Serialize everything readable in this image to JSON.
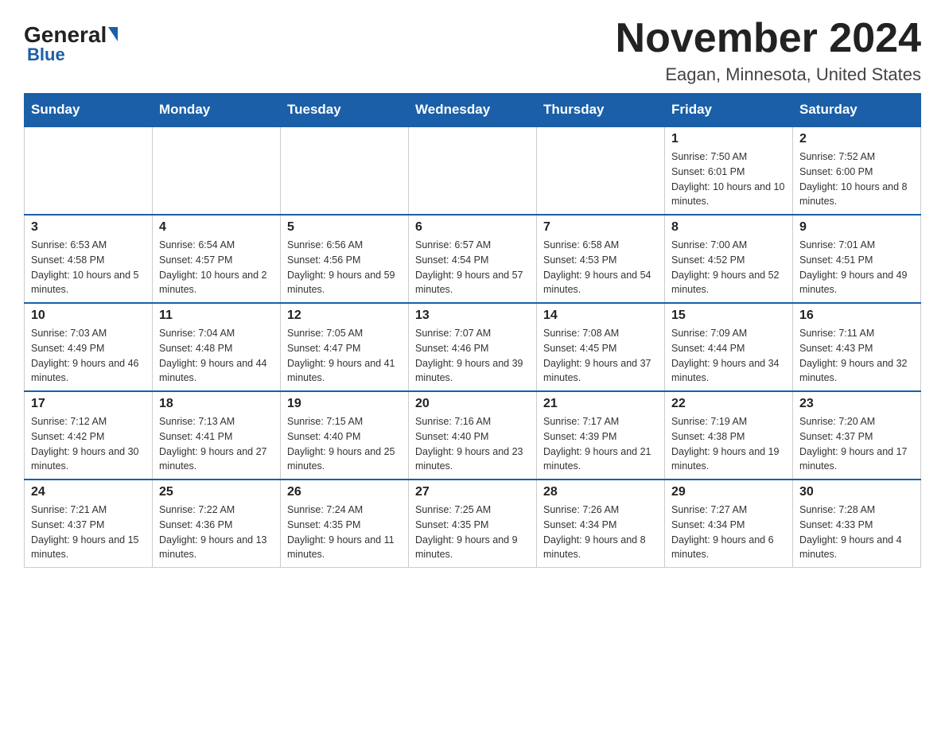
{
  "header": {
    "logo_general": "General",
    "logo_blue": "Blue",
    "main_title": "November 2024",
    "subtitle": "Eagan, Minnesota, United States"
  },
  "days_of_week": [
    "Sunday",
    "Monday",
    "Tuesday",
    "Wednesday",
    "Thursday",
    "Friday",
    "Saturday"
  ],
  "weeks": [
    [
      {
        "day": "",
        "sunrise": "",
        "sunset": "",
        "daylight": ""
      },
      {
        "day": "",
        "sunrise": "",
        "sunset": "",
        "daylight": ""
      },
      {
        "day": "",
        "sunrise": "",
        "sunset": "",
        "daylight": ""
      },
      {
        "day": "",
        "sunrise": "",
        "sunset": "",
        "daylight": ""
      },
      {
        "day": "",
        "sunrise": "",
        "sunset": "",
        "daylight": ""
      },
      {
        "day": "1",
        "sunrise": "Sunrise: 7:50 AM",
        "sunset": "Sunset: 6:01 PM",
        "daylight": "Daylight: 10 hours and 10 minutes."
      },
      {
        "day": "2",
        "sunrise": "Sunrise: 7:52 AM",
        "sunset": "Sunset: 6:00 PM",
        "daylight": "Daylight: 10 hours and 8 minutes."
      }
    ],
    [
      {
        "day": "3",
        "sunrise": "Sunrise: 6:53 AM",
        "sunset": "Sunset: 4:58 PM",
        "daylight": "Daylight: 10 hours and 5 minutes."
      },
      {
        "day": "4",
        "sunrise": "Sunrise: 6:54 AM",
        "sunset": "Sunset: 4:57 PM",
        "daylight": "Daylight: 10 hours and 2 minutes."
      },
      {
        "day": "5",
        "sunrise": "Sunrise: 6:56 AM",
        "sunset": "Sunset: 4:56 PM",
        "daylight": "Daylight: 9 hours and 59 minutes."
      },
      {
        "day": "6",
        "sunrise": "Sunrise: 6:57 AM",
        "sunset": "Sunset: 4:54 PM",
        "daylight": "Daylight: 9 hours and 57 minutes."
      },
      {
        "day": "7",
        "sunrise": "Sunrise: 6:58 AM",
        "sunset": "Sunset: 4:53 PM",
        "daylight": "Daylight: 9 hours and 54 minutes."
      },
      {
        "day": "8",
        "sunrise": "Sunrise: 7:00 AM",
        "sunset": "Sunset: 4:52 PM",
        "daylight": "Daylight: 9 hours and 52 minutes."
      },
      {
        "day": "9",
        "sunrise": "Sunrise: 7:01 AM",
        "sunset": "Sunset: 4:51 PM",
        "daylight": "Daylight: 9 hours and 49 minutes."
      }
    ],
    [
      {
        "day": "10",
        "sunrise": "Sunrise: 7:03 AM",
        "sunset": "Sunset: 4:49 PM",
        "daylight": "Daylight: 9 hours and 46 minutes."
      },
      {
        "day": "11",
        "sunrise": "Sunrise: 7:04 AM",
        "sunset": "Sunset: 4:48 PM",
        "daylight": "Daylight: 9 hours and 44 minutes."
      },
      {
        "day": "12",
        "sunrise": "Sunrise: 7:05 AM",
        "sunset": "Sunset: 4:47 PM",
        "daylight": "Daylight: 9 hours and 41 minutes."
      },
      {
        "day": "13",
        "sunrise": "Sunrise: 7:07 AM",
        "sunset": "Sunset: 4:46 PM",
        "daylight": "Daylight: 9 hours and 39 minutes."
      },
      {
        "day": "14",
        "sunrise": "Sunrise: 7:08 AM",
        "sunset": "Sunset: 4:45 PM",
        "daylight": "Daylight: 9 hours and 37 minutes."
      },
      {
        "day": "15",
        "sunrise": "Sunrise: 7:09 AM",
        "sunset": "Sunset: 4:44 PM",
        "daylight": "Daylight: 9 hours and 34 minutes."
      },
      {
        "day": "16",
        "sunrise": "Sunrise: 7:11 AM",
        "sunset": "Sunset: 4:43 PM",
        "daylight": "Daylight: 9 hours and 32 minutes."
      }
    ],
    [
      {
        "day": "17",
        "sunrise": "Sunrise: 7:12 AM",
        "sunset": "Sunset: 4:42 PM",
        "daylight": "Daylight: 9 hours and 30 minutes."
      },
      {
        "day": "18",
        "sunrise": "Sunrise: 7:13 AM",
        "sunset": "Sunset: 4:41 PM",
        "daylight": "Daylight: 9 hours and 27 minutes."
      },
      {
        "day": "19",
        "sunrise": "Sunrise: 7:15 AM",
        "sunset": "Sunset: 4:40 PM",
        "daylight": "Daylight: 9 hours and 25 minutes."
      },
      {
        "day": "20",
        "sunrise": "Sunrise: 7:16 AM",
        "sunset": "Sunset: 4:40 PM",
        "daylight": "Daylight: 9 hours and 23 minutes."
      },
      {
        "day": "21",
        "sunrise": "Sunrise: 7:17 AM",
        "sunset": "Sunset: 4:39 PM",
        "daylight": "Daylight: 9 hours and 21 minutes."
      },
      {
        "day": "22",
        "sunrise": "Sunrise: 7:19 AM",
        "sunset": "Sunset: 4:38 PM",
        "daylight": "Daylight: 9 hours and 19 minutes."
      },
      {
        "day": "23",
        "sunrise": "Sunrise: 7:20 AM",
        "sunset": "Sunset: 4:37 PM",
        "daylight": "Daylight: 9 hours and 17 minutes."
      }
    ],
    [
      {
        "day": "24",
        "sunrise": "Sunrise: 7:21 AM",
        "sunset": "Sunset: 4:37 PM",
        "daylight": "Daylight: 9 hours and 15 minutes."
      },
      {
        "day": "25",
        "sunrise": "Sunrise: 7:22 AM",
        "sunset": "Sunset: 4:36 PM",
        "daylight": "Daylight: 9 hours and 13 minutes."
      },
      {
        "day": "26",
        "sunrise": "Sunrise: 7:24 AM",
        "sunset": "Sunset: 4:35 PM",
        "daylight": "Daylight: 9 hours and 11 minutes."
      },
      {
        "day": "27",
        "sunrise": "Sunrise: 7:25 AM",
        "sunset": "Sunset: 4:35 PM",
        "daylight": "Daylight: 9 hours and 9 minutes."
      },
      {
        "day": "28",
        "sunrise": "Sunrise: 7:26 AM",
        "sunset": "Sunset: 4:34 PM",
        "daylight": "Daylight: 9 hours and 8 minutes."
      },
      {
        "day": "29",
        "sunrise": "Sunrise: 7:27 AM",
        "sunset": "Sunset: 4:34 PM",
        "daylight": "Daylight: 9 hours and 6 minutes."
      },
      {
        "day": "30",
        "sunrise": "Sunrise: 7:28 AM",
        "sunset": "Sunset: 4:33 PM",
        "daylight": "Daylight: 9 hours and 4 minutes."
      }
    ]
  ]
}
